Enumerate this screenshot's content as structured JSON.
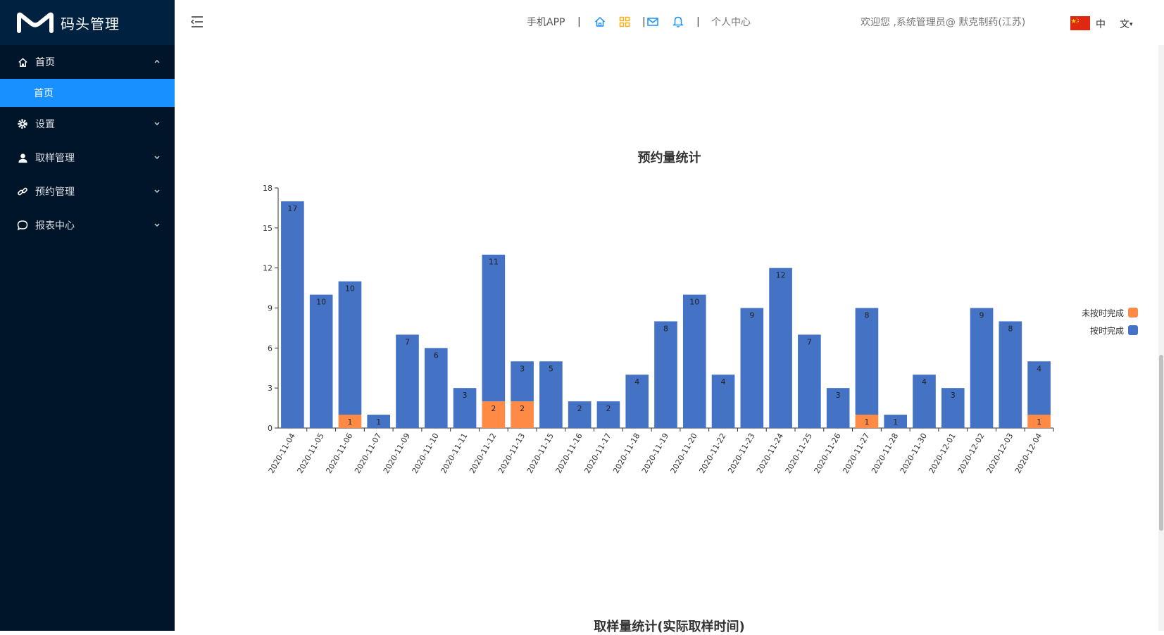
{
  "app": {
    "logo_text": "码头管理"
  },
  "sidebar": {
    "items": [
      {
        "label": "首页",
        "icon": "home-icon",
        "open": true,
        "children": [
          {
            "label": "首页"
          }
        ]
      },
      {
        "label": "设置",
        "icon": "gear-icon"
      },
      {
        "label": "取样管理",
        "icon": "user-icon"
      },
      {
        "label": "预约管理",
        "icon": "link-icon"
      },
      {
        "label": "报表中心",
        "icon": "chat-bubble-icon"
      }
    ]
  },
  "header": {
    "mobile_app": "手机APP",
    "sep": "|",
    "personal_center": "个人中心",
    "welcome": "欢迎您 ,系统管理员@ 默克制药(江苏)",
    "lang_current": "中",
    "lang_menu": "文",
    "accent_blue": "#1890ff",
    "accent_orange": "#faad14"
  },
  "chart_data": [
    {
      "type": "bar",
      "stacked": true,
      "title": "预约量统计",
      "categories": [
        "2020-11-04",
        "2020-11-05",
        "2020-11-06",
        "2020-11-07",
        "2020-11-09",
        "2020-11-10",
        "2020-11-11",
        "2020-11-12",
        "2020-11-13",
        "2020-11-15",
        "2020-11-16",
        "2020-11-17",
        "2020-11-18",
        "2020-11-19",
        "2020-11-20",
        "2020-11-22",
        "2020-11-23",
        "2020-11-24",
        "2020-11-25",
        "2020-11-26",
        "2020-11-27",
        "2020-11-28",
        "2020-11-30",
        "2020-12-01",
        "2020-12-02",
        "2020-12-03",
        "2020-12-04"
      ],
      "series": [
        {
          "name": "未按时完成",
          "color": "#ff8a45",
          "values": [
            0,
            0,
            1,
            0,
            0,
            0,
            0,
            2,
            2,
            0,
            0,
            0,
            0,
            0,
            0,
            0,
            0,
            0,
            0,
            0,
            1,
            0,
            0,
            0,
            0,
            0,
            1
          ]
        },
        {
          "name": "按时完成",
          "color": "#4472c4",
          "values": [
            17,
            10,
            10,
            1,
            7,
            6,
            3,
            11,
            3,
            5,
            2,
            2,
            4,
            8,
            10,
            4,
            9,
            12,
            7,
            3,
            8,
            1,
            4,
            3,
            9,
            8,
            4
          ]
        }
      ],
      "ylim": [
        0,
        18
      ],
      "yticks": [
        0,
        3,
        6,
        9,
        12,
        15,
        18
      ],
      "legend_position": "right"
    },
    {
      "type": "bar",
      "title": "取样量统计(实际取样时间)"
    }
  ]
}
